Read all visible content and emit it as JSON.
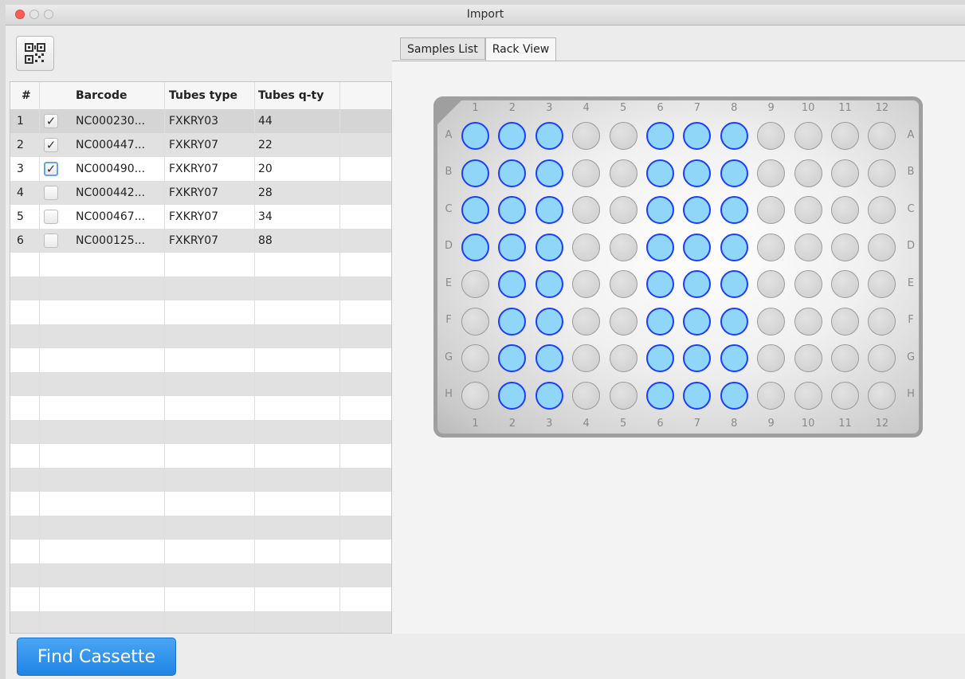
{
  "window": {
    "title": "Import"
  },
  "toolbar": {
    "qr_icon": "qr-code-icon"
  },
  "table": {
    "columns": [
      "#",
      "Barcode",
      "Tubes type",
      "Tubes q-ty"
    ],
    "rows": [
      {
        "num": "1",
        "checked": true,
        "barcode": "NC000230...",
        "tube_type": "FXKRY03",
        "qty": "44"
      },
      {
        "num": "2",
        "checked": true,
        "barcode": "NC000447...",
        "tube_type": "FXKRY07",
        "qty": "22"
      },
      {
        "num": "3",
        "checked": true,
        "barcode": "NC000490...",
        "tube_type": "FXKRY07",
        "qty": "20"
      },
      {
        "num": "4",
        "checked": false,
        "barcode": "NC000442...",
        "tube_type": "FXKRY07",
        "qty": "28"
      },
      {
        "num": "5",
        "checked": false,
        "barcode": "NC000467...",
        "tube_type": "FXKRY07",
        "qty": "34"
      },
      {
        "num": "6",
        "checked": false,
        "barcode": "NC000125...",
        "tube_type": "FXKRY07",
        "qty": "88"
      }
    ]
  },
  "tabs": {
    "samples_list": "Samples List",
    "rack_view": "Rack View",
    "active": "Rack View"
  },
  "rack": {
    "columns": [
      "1",
      "2",
      "3",
      "4",
      "5",
      "6",
      "7",
      "8",
      "9",
      "10",
      "11",
      "12"
    ],
    "rows": [
      "A",
      "B",
      "C",
      "D",
      "E",
      "F",
      "G",
      "H"
    ],
    "filled": {
      "A": [
        1,
        2,
        3,
        6,
        7,
        8
      ],
      "B": [
        1,
        2,
        3,
        6,
        7,
        8
      ],
      "C": [
        1,
        2,
        3,
        6,
        7,
        8
      ],
      "D": [
        1,
        2,
        3,
        6,
        7,
        8
      ],
      "E": [
        2,
        3,
        6,
        7,
        8
      ],
      "F": [
        2,
        3,
        6,
        7,
        8
      ],
      "G": [
        2,
        3,
        6,
        7,
        8
      ],
      "H": [
        2,
        3,
        6,
        7,
        8
      ]
    },
    "colors": {
      "filled": "#8fd6f8",
      "filled_border": "#1c3cff",
      "empty": "#d3d3d3"
    }
  },
  "footer": {
    "find_cassette": "Find Cassette"
  }
}
